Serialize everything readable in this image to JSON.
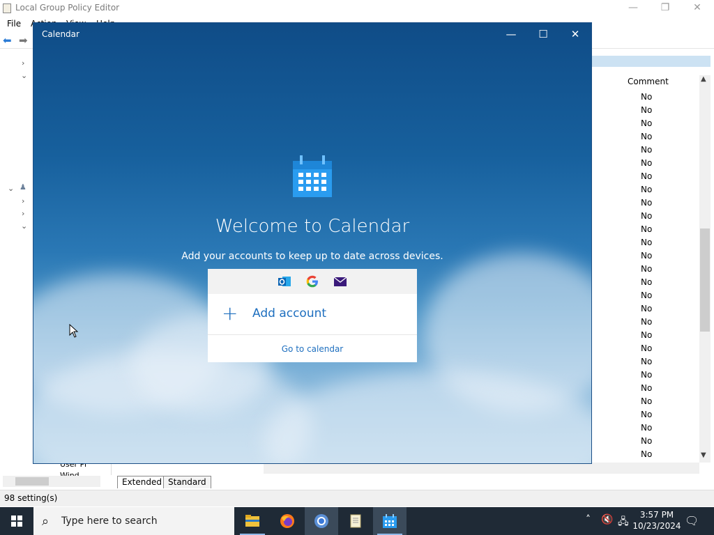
{
  "mmc": {
    "title": "Local Group Policy Editor",
    "menu": [
      "File",
      "Action",
      "View",
      "Help"
    ],
    "list_header": "Comment",
    "rows": [
      "No",
      "No",
      "No",
      "No",
      "No",
      "No",
      "No",
      "No",
      "No",
      "No",
      "No",
      "No",
      "No",
      "No",
      "No",
      "No",
      "No",
      "No",
      "No",
      "No",
      "No",
      "No",
      "No",
      "No",
      "No",
      "No",
      "No",
      "No",
      "No"
    ],
    "tree_fragments": {
      "user": "User Pr",
      "win": "Wind"
    },
    "tabs": [
      "Extended",
      "Standard"
    ],
    "status": "98 setting(s)"
  },
  "calendar": {
    "title": "Calendar",
    "welcome": "Welcome to Calendar",
    "subtitle": "Add your accounts to keep up to date across devices.",
    "add_account": "Add account",
    "add_symbol": "+",
    "go_to_calendar": "Go to calendar"
  },
  "taskbar": {
    "search_placeholder": "Type here to search",
    "time": "3:57 PM",
    "date": "10/23/2024"
  },
  "colors": {
    "accent": "#1e6fbf",
    "taskbar": "#1f2a36",
    "calendar_top": "#0f4c87"
  }
}
